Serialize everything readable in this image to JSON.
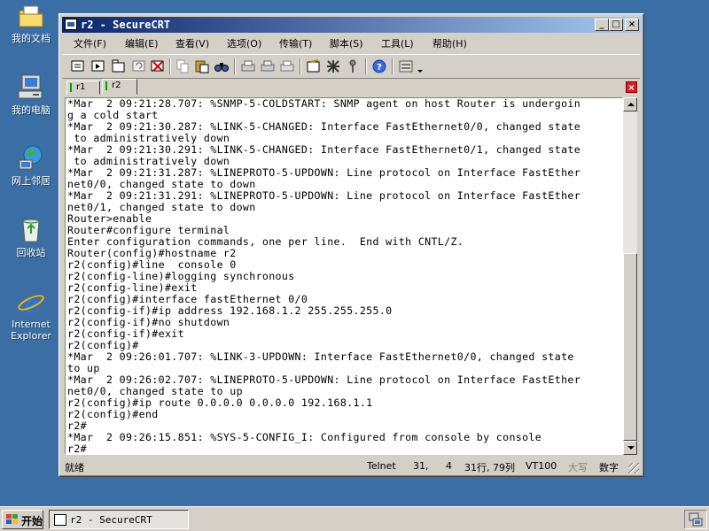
{
  "desktop": {
    "icons": [
      {
        "label": "我的文档",
        "icon": "my-documents-icon"
      },
      {
        "label": "我的电脑",
        "icon": "my-computer-icon"
      },
      {
        "label": "网上邻居",
        "icon": "network-places-icon"
      },
      {
        "label": "回收站",
        "icon": "recycle-bin-icon"
      },
      {
        "label": "Internet Explorer",
        "icon": "internet-explorer-icon"
      }
    ]
  },
  "window": {
    "title": "r2 - SecureCRT",
    "controls": {
      "minimize": "_",
      "maximize": "□",
      "close": "×"
    }
  },
  "menu": {
    "items": [
      "文件(F)",
      "编辑(E)",
      "查看(V)",
      "选项(O)",
      "传输(T)",
      "脚本(S)",
      "工具(L)",
      "帮助(H)"
    ]
  },
  "tabs": [
    {
      "label": "r1",
      "active": false
    },
    {
      "label": "r2",
      "active": true
    }
  ],
  "terminal": {
    "lines": [
      "*Mar  2 09:21:28.707: %SNMP-5-COLDSTART: SNMP agent on host Router is undergoin",
      "g a cold start",
      "*Mar  2 09:21:30.287: %LINK-5-CHANGED: Interface FastEthernet0/0, changed state",
      " to administratively down",
      "*Mar  2 09:21:30.291: %LINK-5-CHANGED: Interface FastEthernet0/1, changed state",
      " to administratively down",
      "*Mar  2 09:21:31.287: %LINEPROTO-5-UPDOWN: Line protocol on Interface FastEther",
      "net0/0, changed state to down",
      "*Mar  2 09:21:31.291: %LINEPROTO-5-UPDOWN: Line protocol on Interface FastEther",
      "net0/1, changed state to down",
      "Router>enable",
      "Router#configure terminal",
      "Enter configuration commands, one per line.  End with CNTL/Z.",
      "Router(config)#hostname r2",
      "r2(config)#line  console 0",
      "r2(config-line)#logging synchronous",
      "r2(config-line)#exit",
      "r2(config)#interface fastEthernet 0/0",
      "r2(config-if)#ip address 192.168.1.2 255.255.255.0",
      "r2(config-if)#no shutdown",
      "r2(config-if)#exit",
      "r2(config)#",
      "*Mar  2 09:26:01.707: %LINK-3-UPDOWN: Interface FastEthernet0/0, changed state",
      "to up",
      "*Mar  2 09:26:02.707: %LINEPROTO-5-UPDOWN: Line protocol on Interface FastEther",
      "net0/0, changed state to up",
      "r2(config)#ip route 0.0.0.0 0.0.0.0 192.168.1.1",
      "r2(config)#end",
      "r2#",
      "*Mar  2 09:26:15.851: %SYS-5-CONFIG_I: Configured from console by console",
      "r2#"
    ]
  },
  "status": {
    "ready": "就绪",
    "protocol": "Telnet",
    "row": "31,",
    "col": "4",
    "rowscols": "31行, 79列",
    "emulation": "VT100",
    "caps": "大写",
    "num": "数字"
  },
  "taskbar": {
    "start_label": "开始",
    "task_label": "r2 - SecureCRT"
  },
  "colors": {
    "desktop": "#3a6ea5",
    "title_active_start": "#0a246a",
    "title_active_end": "#a6caf0",
    "face": "#d4d0c8",
    "terminal_bg": "#ffffff"
  }
}
